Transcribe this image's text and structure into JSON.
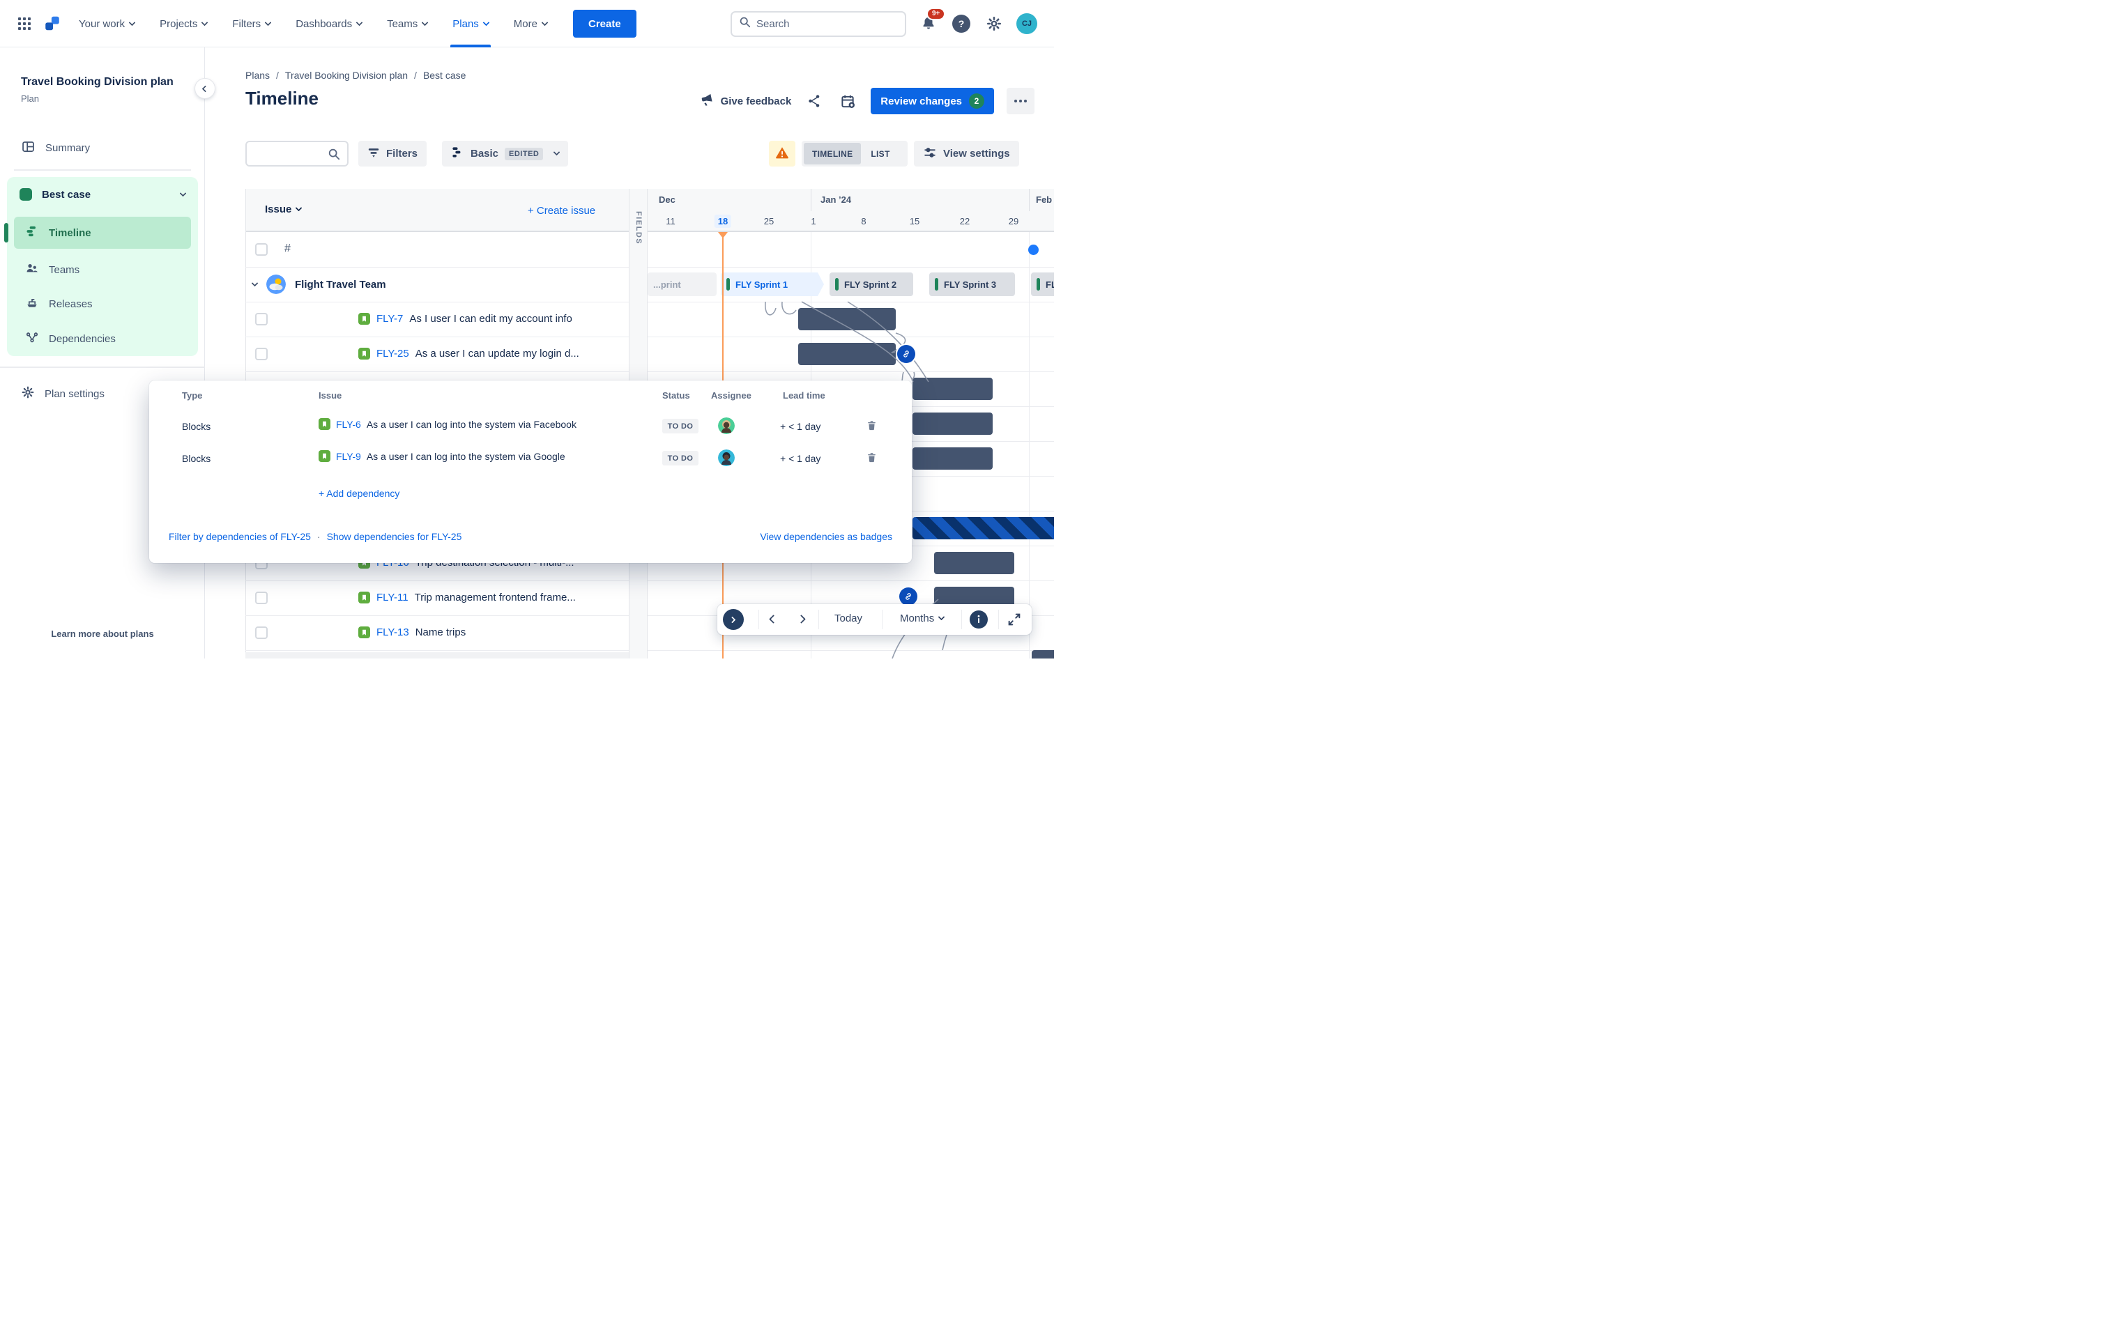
{
  "nav": {
    "items": [
      {
        "label": "Your work"
      },
      {
        "label": "Projects"
      },
      {
        "label": "Filters"
      },
      {
        "label": "Dashboards"
      },
      {
        "label": "Teams"
      },
      {
        "label": "Plans"
      },
      {
        "label": "More"
      }
    ],
    "active_item": "Plans",
    "create_label": "Create",
    "search_placeholder": "Search",
    "notifications_badge": "9+",
    "avatar_initials": "CJ"
  },
  "sidebar": {
    "plan_title": "Travel Booking Division plan",
    "plan_subtitle": "Plan",
    "summary_label": "Summary",
    "scenario_label": "Best case",
    "items": [
      {
        "label": "Timeline",
        "selected": true
      },
      {
        "label": "Teams"
      },
      {
        "label": "Releases"
      },
      {
        "label": "Dependencies"
      }
    ],
    "plan_settings_label": "Plan settings",
    "learn_more_label": "Learn more about plans"
  },
  "header": {
    "breadcrumb": [
      "Plans",
      "Travel Booking Division plan",
      "Best case"
    ],
    "title": "Timeline",
    "give_feedback_label": "Give feedback",
    "review_changes_label": "Review changes",
    "review_changes_count": "2"
  },
  "toolbar": {
    "filters_label": "Filters",
    "view_mode_label": "Basic",
    "view_mode_badge": "EDITED",
    "timeline_toggle": "TIMELINE",
    "list_toggle": "LIST",
    "view_settings_label": "View settings"
  },
  "table": {
    "issue_header": "Issue",
    "create_issue_label": "+ Create issue",
    "fields_label": "FIELDS",
    "hash_label": "#",
    "team_name": "Flight Travel Team",
    "rows": [
      {
        "key": "FLY-7",
        "title": "As I user I can edit my account info"
      },
      {
        "key": "FLY-25",
        "title": "As a user I can update my login d..."
      },
      {
        "key": "FLY-16",
        "title": "Trip destination selection - multi-..."
      },
      {
        "key": "FLY-11",
        "title": "Trip management frontend frame..."
      },
      {
        "key": "FLY-13",
        "title": "Name trips"
      }
    ]
  },
  "timeline": {
    "months": [
      "Dec",
      "Jan ’24",
      "Feb"
    ],
    "dates": [
      "11",
      "18",
      "25",
      "1",
      "8",
      "15",
      "22",
      "29"
    ],
    "today_date": "18",
    "sprints": [
      {
        "label": "...print"
      },
      {
        "label": "FLY Sprint 1",
        "active": true
      },
      {
        "label": "FLY Sprint 2"
      },
      {
        "label": "FLY Sprint 3"
      },
      {
        "label": "FLY Sprin"
      }
    ]
  },
  "dependencies_popup": {
    "columns": [
      "Type",
      "Issue",
      "Status",
      "Assignee",
      "Lead time"
    ],
    "rows": [
      {
        "type": "Blocks",
        "key": "FLY-6",
        "title": "As a user I can log into the system via Facebook",
        "status": "TO DO",
        "lead_time": "+ < 1 day"
      },
      {
        "type": "Blocks",
        "key": "FLY-9",
        "title": "As a user I can log into the system via Google",
        "status": "TO DO",
        "lead_time": "+ < 1 day"
      }
    ],
    "add_dependency_label": "+ Add dependency",
    "filter_link": "Filter by dependencies of FLY-25",
    "separator": "·",
    "show_link": "Show dependencies for FLY-25",
    "view_badges_link": "View dependencies as badges"
  },
  "timeline_controls": {
    "today_label": "Today",
    "zoom_value": "Months"
  },
  "icons": {
    "app_switcher": "grid-dots",
    "logo": "jira-mark",
    "notifications": "bell",
    "help": "question-circle",
    "settings": "gear",
    "profile": "avatar",
    "feedback": "megaphone",
    "share": "share-nodes",
    "add_to_calendar": "calendar-plus",
    "filters": "funnel",
    "view_mode": "offset-bars",
    "warning": "warning-triangle",
    "view_settings": "sliders",
    "dependency_link": "chain-link",
    "delete": "trash",
    "info": "info-circle",
    "expand": "diagonal-arrows"
  },
  "colors": {
    "accent_blue": "#0C66E4",
    "brand_green": "#1F845A",
    "mint_panel": "#E3FCEF",
    "mint_selected": "#BBEBD1",
    "bar_slate": "#44546F",
    "today_orange": "#FB9C59",
    "warning_orange": "#E56910",
    "hatch_navy": "#09326C",
    "hatch_blue": "#1558BC",
    "badge_red": "#CA3521"
  }
}
